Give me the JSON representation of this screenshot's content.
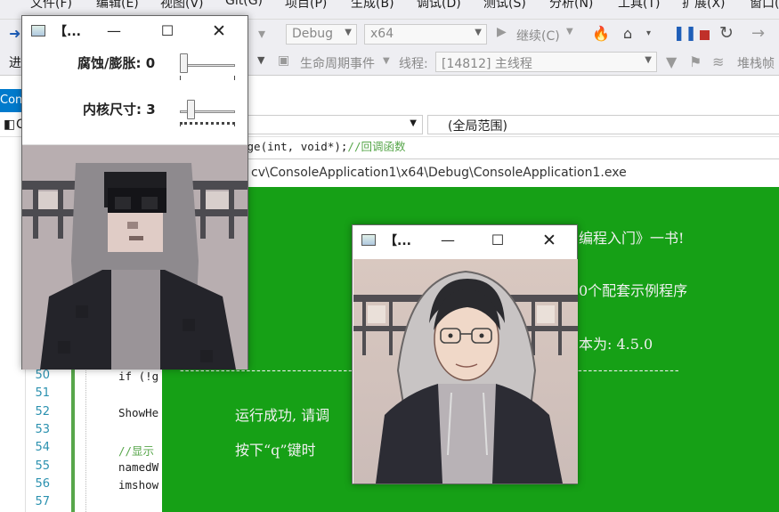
{
  "menu": {
    "items": [
      "文件(F)",
      "编辑(E)",
      "视图(V)",
      "Git(G)",
      "项目(P)",
      "生成(B)",
      "调试(D)",
      "测试(S)",
      "分析(N)",
      "工具(T)",
      "扩展(X)",
      "窗口("
    ]
  },
  "toolbar": {
    "config": "Debug",
    "platform": "x64",
    "continue_label": "继续(C)",
    "process_label": "进",
    "lifecycle_label": "生命周期事件",
    "thread_label": "线程:",
    "thread_value": "[14812] 主线程",
    "stackframe_label": "堆栈帧"
  },
  "editor": {
    "tab_label": "Con",
    "nav_left": "C",
    "nav_scope": "(全局范围)",
    "code_fragment": "nge(int, void*);//回调函数",
    "line_numbers": [
      "50",
      "51",
      "52",
      "53",
      "54",
      "55",
      "56",
      "57"
    ],
    "code_lines": [
      "if (!g",
      "",
      "ShowHe",
      "",
      "//显示",
      "namedW",
      "imshow",
      ""
    ]
  },
  "console": {
    "title": "cv\\ConsoleApplication1\\x64\\Debug\\ConsoleApplication1.exe",
    "lines": [
      "编程入门》一书!",
      "0个配套示例程序",
      "本为: 4.5.0",
      "--------------------------------------------------------------------------------------------------",
      "运行成功, 请调",
      "按下“q”键时"
    ]
  },
  "trackbar_window": {
    "title": "【...",
    "erode_label": "腐蚀/膨胀: 0",
    "kernel_label": "内核尺寸: 3",
    "erode_value": 0,
    "kernel_value": 3
  },
  "original_window": {
    "title": "【..."
  },
  "colors": {
    "console_bg": "#16a016",
    "accent": "#007acc",
    "line_number": "#2b91af",
    "change_bar": "#57a64a"
  }
}
